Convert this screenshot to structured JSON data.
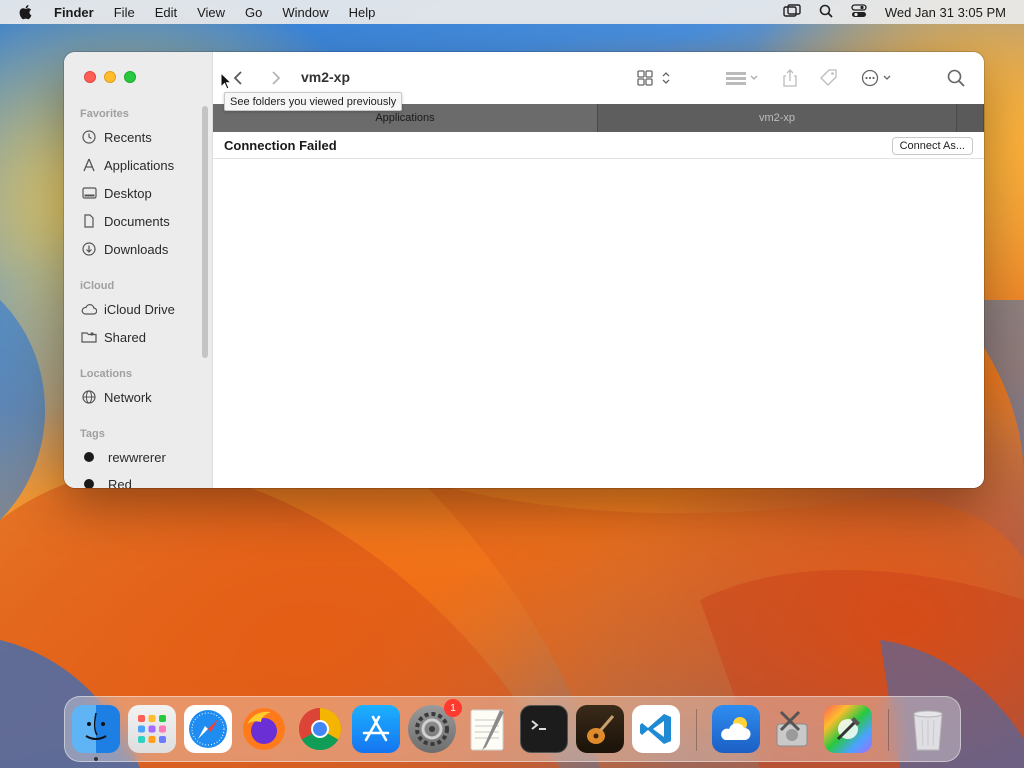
{
  "menubar": {
    "app": "Finder",
    "items": [
      "File",
      "Edit",
      "View",
      "Go",
      "Window",
      "Help"
    ],
    "datetime": "Wed Jan 31  3:05 PM"
  },
  "window": {
    "title": "vm2-xp",
    "tooltip": "See folders you viewed previously",
    "tabs": [
      "Applications",
      "vm2-xp"
    ],
    "status_title": "Connection Failed",
    "connect_button": "Connect As..."
  },
  "sidebar": {
    "favorites_label": "Favorites",
    "favorites": [
      {
        "label": "Recents",
        "icon": "clock-icon"
      },
      {
        "label": "Applications",
        "icon": "applications-icon"
      },
      {
        "label": "Desktop",
        "icon": "desktop-icon"
      },
      {
        "label": "Documents",
        "icon": "document-icon"
      },
      {
        "label": "Downloads",
        "icon": "download-icon"
      }
    ],
    "icloud_label": "iCloud",
    "icloud": [
      {
        "label": "iCloud Drive",
        "icon": "cloud-icon"
      },
      {
        "label": "Shared",
        "icon": "shared-folder-icon"
      }
    ],
    "locations_label": "Locations",
    "locations": [
      {
        "label": "Network",
        "icon": "globe-icon"
      }
    ],
    "tags_label": "Tags",
    "tags": [
      {
        "label": "rewwrerer",
        "color": "#1a1a1a"
      },
      {
        "label": "Red",
        "color": "#1a1a1a"
      }
    ]
  },
  "dock": {
    "apps": [
      "Finder",
      "Launchpad",
      "Safari",
      "Firefox",
      "Chrome",
      "App Store",
      "System Settings",
      "TextEdit",
      "Terminal",
      "GarageBand",
      "Visual Studio Code",
      "Weather",
      "Disk Utility",
      "Xcode Tools",
      "Trash"
    ],
    "settings_badge": "1"
  }
}
